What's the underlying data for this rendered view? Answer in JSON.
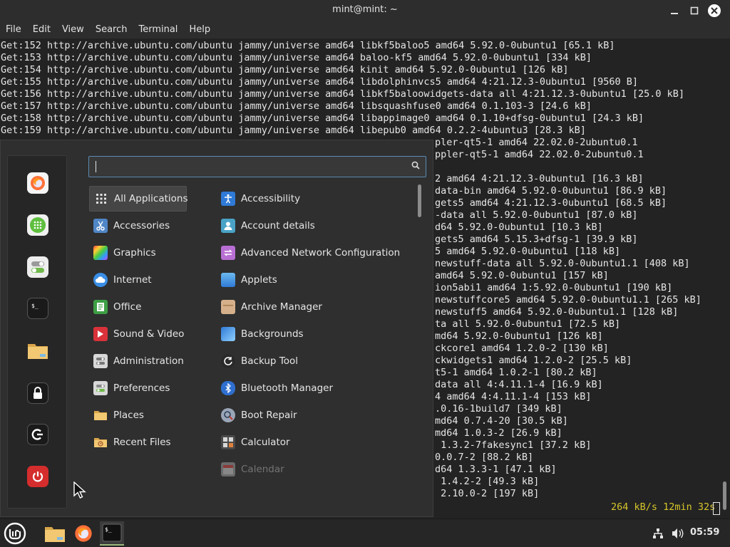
{
  "window": {
    "title": "mint@mint: ~",
    "menu": [
      "File",
      "Edit",
      "View",
      "Search",
      "Terminal",
      "Help"
    ]
  },
  "terminal": {
    "full_lines": [
      "Get:152 http://archive.ubuntu.com/ubuntu jammy/universe amd64 libkf5baloo5 amd64 5.92.0-0ubuntu1 [65.1 kB]",
      "Get:153 http://archive.ubuntu.com/ubuntu jammy/universe amd64 baloo-kf5 amd64 5.92.0-0ubuntu1 [334 kB]",
      "Get:154 http://archive.ubuntu.com/ubuntu jammy/universe amd64 kinit amd64 5.92.0-0ubuntu1 [126 kB]",
      "Get:155 http://archive.ubuntu.com/ubuntu jammy/universe amd64 libdolphinvcs5 amd64 4:21.12.3-0ubuntu1 [9560 B]",
      "Get:156 http://archive.ubuntu.com/ubuntu jammy/universe amd64 libkf5baloowidgets-data all 4:21.12.3-0ubuntu1 [25.0 kB]",
      "Get:157 http://archive.ubuntu.com/ubuntu jammy/universe amd64 libsquashfuse0 amd64 0.1.103-3 [24.6 kB]",
      "Get:158 http://archive.ubuntu.com/ubuntu jammy/universe amd64 libappimage0 amd64 0.1.10+dfsg-0ubuntu1 [24.3 kB]",
      "Get:159 http://archive.ubuntu.com/ubuntu jammy/universe amd64 libepub0 amd64 0.2.2-4ubuntu3 [28.3 kB]"
    ],
    "partial_lines": [
      "pler-qt5-1 amd64 22.02.0-2ubuntu0.1",
      "ppler-qt5-1 amd64 22.02.0-2ubuntu0.1",
      "",
      "2 amd64 4:21.12.3-0ubuntu1 [16.3 kB]",
      "data-bin amd64 5.92.0-0ubuntu1 [86.9 kB]",
      "gets5 amd64 4:21.12.3-0ubuntu1 [68.5 kB]",
      "-data all 5.92.0-0ubuntu1 [87.0 kB]",
      "d64 5.92.0-0ubuntu1 [10.3 kB]",
      "gets5 amd64 5.15.3+dfsg-1 [39.9 kB]",
      "5 amd64 5.92.0-0ubuntu1 [118 kB]",
      "newstuff-data all 5.92.0-0ubuntu1.1 [408 kB]",
      "amd64 5.92.0-0ubuntu1 [157 kB]",
      "ion5abi1 amd64 1:5.92.0-0ubuntu1 [190 kB]",
      "newstuffcore5 amd64 5.92.0-0ubuntu1.1 [265 kB]",
      "newstuff5 amd64 5.92.0-0ubuntu1.1 [128 kB]",
      "ta all 5.92.0-0ubuntu1 [72.5 kB]",
      "md64 5.92.0-0ubuntu1 [126 kB]",
      "ckcore1 amd64 1.2.0-2 [130 kB]",
      "ckwidgets1 amd64 1.2.0-2 [25.5 kB]",
      "t5-1 amd64 1.0.2-1 [80.2 kB]",
      "data all 4:4.11.1-4 [16.9 kB]",
      "4 amd64 4:4.11.1-4 [153 kB]",
      ".0.16-1build7 [349 kB]",
      "md64 0.7.4-20 [30.5 kB]",
      "md64 1.0.3-2 [26.9 kB]",
      " 1.3.2-7fakesync1 [37.2 kB]",
      "0.0.7-2 [88.2 kB]",
      "d64 1.3.3-1 [47.1 kB]",
      " 1.4.2-2 [49.3 kB]",
      " 2.10.0-2 [197 kB]"
    ],
    "progress": "264 kB/s 12min 32s"
  },
  "menu": {
    "search_placeholder": "",
    "favorites": [
      "firefox-icon",
      "calculator-app-icon",
      "settings-toggle-icon",
      "terminal-icon",
      "folder-icon",
      "lock-icon",
      "logout-icon",
      "power-icon"
    ],
    "categories": [
      {
        "label": "All Applications",
        "icon": "grid-icon",
        "color": "#4a4a4a"
      },
      {
        "label": "Accessories",
        "icon": "scissors-icon",
        "color": "#4f86c6"
      },
      {
        "label": "Graphics",
        "icon": "palette-icon",
        "color": "#c24bd1"
      },
      {
        "label": "Internet",
        "icon": "cloud-icon",
        "color": "#3a8ee6"
      },
      {
        "label": "Office",
        "icon": "document-icon",
        "color": "#3d9f45"
      },
      {
        "label": "Sound & Video",
        "icon": "play-icon",
        "color": "#d9323b"
      },
      {
        "label": "Administration",
        "icon": "admin-icon",
        "color": "#d8d8d8"
      },
      {
        "label": "Preferences",
        "icon": "preferences-icon",
        "color": "#d8d8d8"
      },
      {
        "label": "Places",
        "icon": "folder-icon",
        "color": "#e9b85a"
      },
      {
        "label": "Recent Files",
        "icon": "recent-files-icon",
        "color": "#e9b85a"
      }
    ],
    "apps": [
      {
        "label": "Accessibility",
        "icon": "accessibility-icon",
        "color": "#2f7ad6"
      },
      {
        "label": "Account details",
        "icon": "account-icon",
        "color": "#4aa3c7"
      },
      {
        "label": "Advanced Network Configuration",
        "icon": "network-icon",
        "color": "#b86fd3"
      },
      {
        "label": "Applets",
        "icon": "applets-icon",
        "color": "#4aa3e6"
      },
      {
        "label": "Archive Manager",
        "icon": "archive-icon",
        "color": "#d6b08a"
      },
      {
        "label": "Backgrounds",
        "icon": "backgrounds-icon",
        "color": "#5aa6e8"
      },
      {
        "label": "Backup Tool",
        "icon": "backup-icon",
        "color": "#3a3a3a"
      },
      {
        "label": "Bluetooth Manager",
        "icon": "bluetooth-icon",
        "color": "#2f6fd0"
      },
      {
        "label": "Boot Repair",
        "icon": "boot-repair-icon",
        "color": "#9aa6b8"
      },
      {
        "label": "Calculator",
        "icon": "calculator-icon",
        "color": "#4a4a4a"
      },
      {
        "label": "Calendar",
        "icon": "calendar-icon",
        "color": "#6b6b6b"
      }
    ]
  },
  "taskbar": {
    "clock": "05:59"
  }
}
